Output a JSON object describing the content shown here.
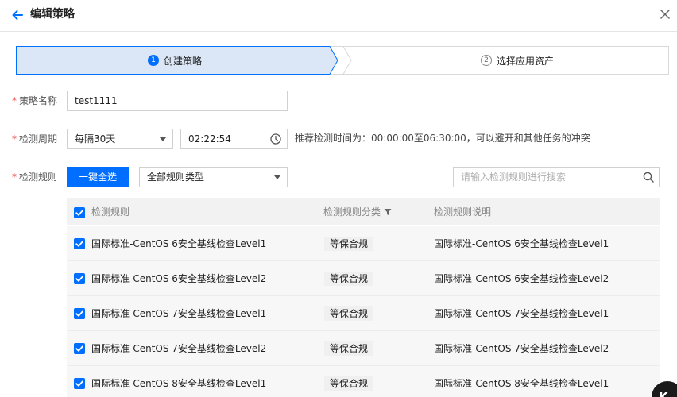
{
  "header": {
    "title": "编辑策略"
  },
  "steps": [
    {
      "number": "1",
      "label": "创建策略",
      "active": true
    },
    {
      "number": "2",
      "label": "选择应用资产",
      "active": false
    }
  ],
  "form": {
    "name": {
      "label": "策略名称",
      "value": "test1111"
    },
    "period": {
      "label": "检测周期",
      "interval": "每隔30天",
      "time": "02:22:54",
      "hint": "推荐检测时间为：00:00:00至06:30:00，可以避开和其他任务的冲突"
    },
    "rules": {
      "label": "检测规则",
      "select_all_button": "一键全选",
      "type_select": "全部规则类型",
      "search_placeholder": "请输入检测规则进行搜索"
    }
  },
  "table": {
    "columns": [
      "检测规则",
      "检测规则分类",
      "检测规则说明"
    ],
    "rows": [
      {
        "rule": "国际标准-CentOS 6安全基线检查Level1",
        "category": "等保合规",
        "desc": "国际标准-CentOS 6安全基线检查Level1"
      },
      {
        "rule": "国际标准-CentOS 6安全基线检查Level2",
        "category": "等保合规",
        "desc": "国际标准-CentOS 6安全基线检查Level2"
      },
      {
        "rule": "国际标准-CentOS 7安全基线检查Level1",
        "category": "等保合规",
        "desc": "国际标准-CentOS 7安全基线检查Level1"
      },
      {
        "rule": "国际标准-CentOS 7安全基线检查Level2",
        "category": "等保合规",
        "desc": "国际标准-CentOS 7安全基线检查Level2"
      },
      {
        "rule": "国际标准-CentOS 8安全基线检查Level1",
        "category": "等保合规",
        "desc": "国际标准-CentOS 8安全基线检查Level1"
      }
    ]
  },
  "badge": {
    "text": "K"
  },
  "colors": {
    "primary": "#006eff",
    "step_active_bg": "#dbe7f6",
    "required": "#e54545"
  }
}
